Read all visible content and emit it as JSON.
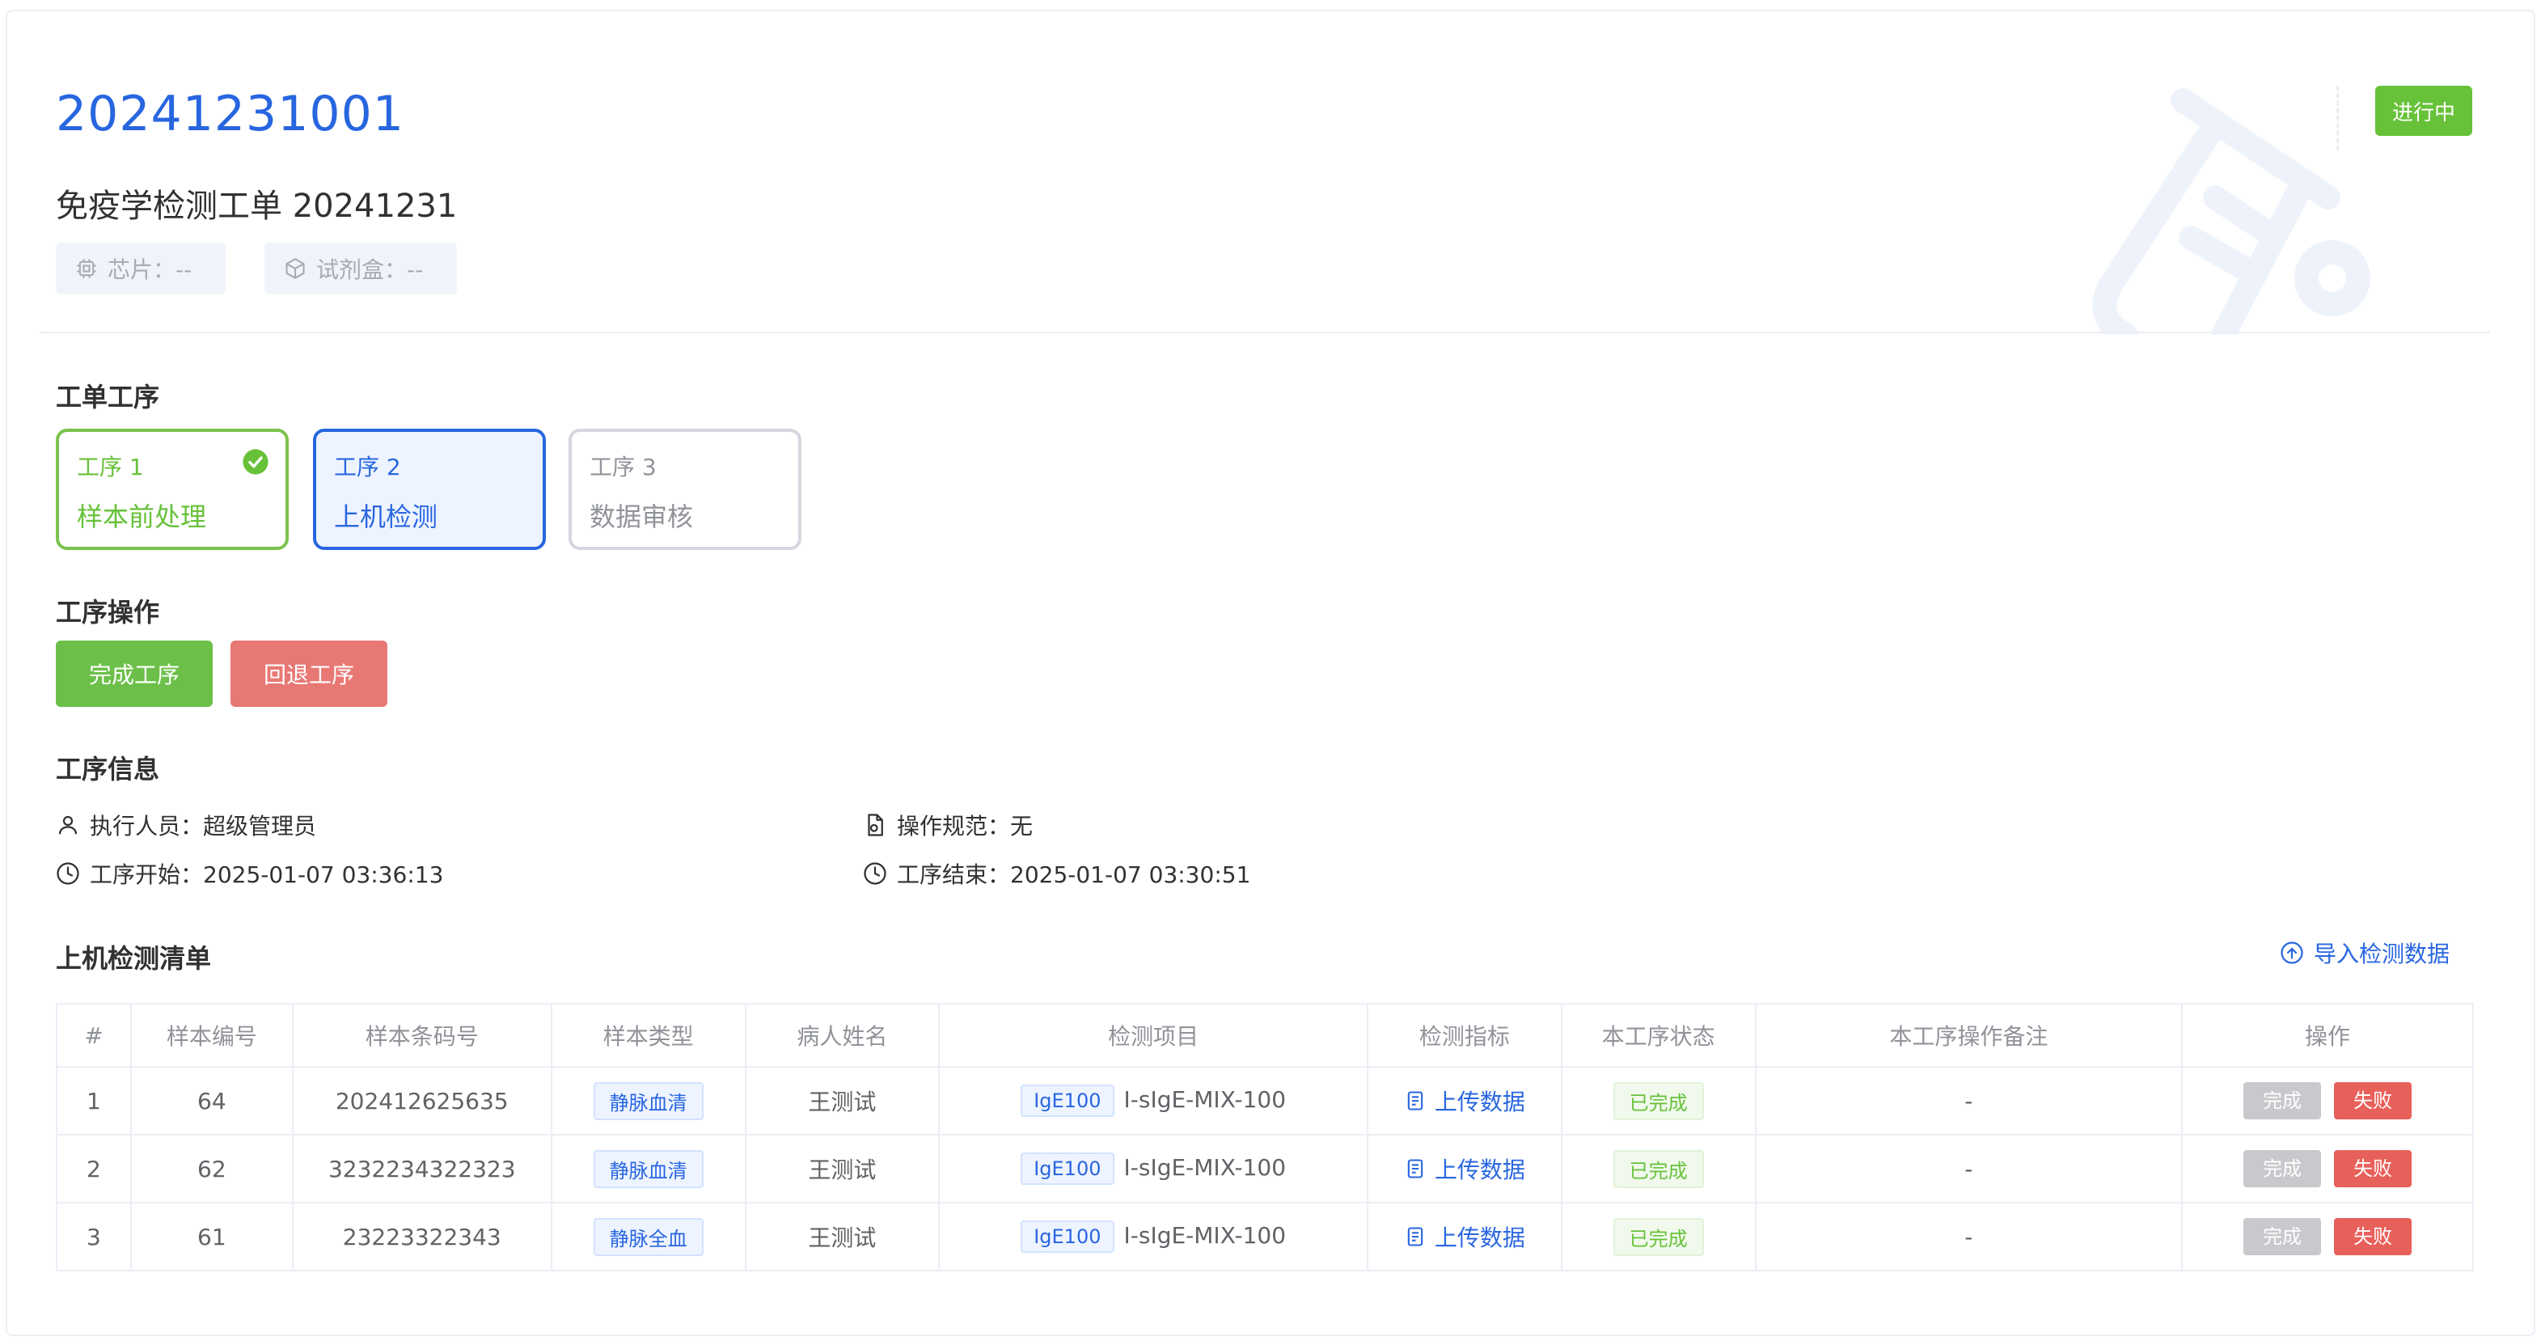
{
  "header": {
    "order_no": "20241231001",
    "order_title": "免疫学检测工单 20241231",
    "chip": "芯片：--",
    "kit": "试剂盒：--",
    "status": "进行中"
  },
  "colors": {
    "primary": "#2866e0",
    "success": "#67c23a",
    "danger": "#e87874",
    "muted": "#909399"
  },
  "sections": {
    "process": "工单工序",
    "operation": "工序操作",
    "info": "工序信息",
    "list": "上机检测清单"
  },
  "steps": [
    {
      "no": "工序 1",
      "name": "样本前处理",
      "state": "done"
    },
    {
      "no": "工序 2",
      "name": "上机检测",
      "state": "active"
    },
    {
      "no": "工序 3",
      "name": "数据审核",
      "state": "pending"
    }
  ],
  "operations": {
    "complete": "完成工序",
    "rollback": "回退工序"
  },
  "info": {
    "executor": "执行人员：超级管理员",
    "spec": "操作规范：无",
    "start": "工序开始：2025-01-07 03:36:13",
    "end": "工序结束：2025-01-07 03:30:51"
  },
  "import_label": "导入检测数据",
  "table": {
    "headers": [
      "#",
      "样本编号",
      "样本条码号",
      "样本类型",
      "病人姓名",
      "检测项目",
      "检测指标",
      "本工序状态",
      "本工序操作备注",
      "操作"
    ],
    "rows": [
      {
        "idx": "1",
        "sample_no": "64",
        "barcode": "202412625635",
        "type": "静脉血清",
        "patient": "王测试",
        "item_tag": "IgE100",
        "item": "I-sIgE-MIX-100",
        "indicator": "上传数据",
        "status": "已完成",
        "remark": "-",
        "btn_done": "完成",
        "btn_fail": "失败"
      },
      {
        "idx": "2",
        "sample_no": "62",
        "barcode": "3232234322323",
        "type": "静脉血清",
        "patient": "王测试",
        "item_tag": "IgE100",
        "item": "I-sIgE-MIX-100",
        "indicator": "上传数据",
        "status": "已完成",
        "remark": "-",
        "btn_done": "完成",
        "btn_fail": "失败"
      },
      {
        "idx": "3",
        "sample_no": "61",
        "barcode": "23223322343",
        "type": "静脉全血",
        "patient": "王测试",
        "item_tag": "IgE100",
        "item": "I-sIgE-MIX-100",
        "indicator": "上传数据",
        "status": "已完成",
        "remark": "-",
        "btn_done": "完成",
        "btn_fail": "失败"
      }
    ]
  },
  "icons": {
    "chip": "chip-icon",
    "kit": "box-icon",
    "check": "check-circle-icon",
    "user": "user-icon",
    "doc": "document-icon",
    "clock": "clock-icon",
    "upload": "upload-circle-icon",
    "file": "file-text-icon",
    "watermark": "test-tube-icon"
  }
}
